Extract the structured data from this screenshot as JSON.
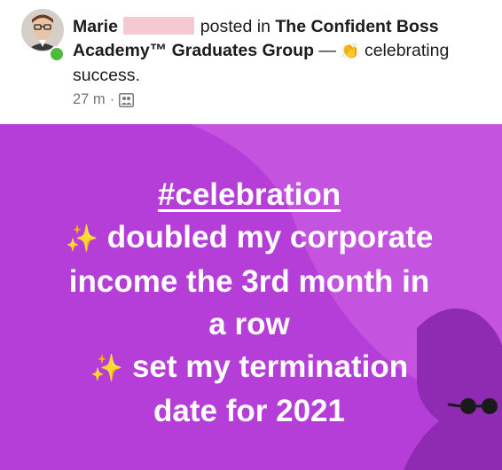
{
  "post_header": {
    "author_first": "Marie",
    "posted_in": "posted in",
    "group_name": "The Confident Boss Academy™ Graduates Group",
    "dash": "—",
    "feeling_emoji": "👏",
    "feeling_text": "celebrating success.",
    "time": "27 m",
    "separator": "·",
    "audience_icon": "group-icon"
  },
  "post_body": {
    "hashtag_symbol": "#",
    "hashtag": "celebration",
    "sparkle": "✨",
    "line1": "doubled my corporate",
    "line2": "income the 3rd month in",
    "line3": "a row",
    "line4": "set my termination",
    "line5": "date for 2021"
  },
  "colors": {
    "background_purple": "#b63ed8",
    "background_wave": "#c453e0",
    "silhouette": "#8f2ab3",
    "online_status": "#4cbb3c"
  }
}
